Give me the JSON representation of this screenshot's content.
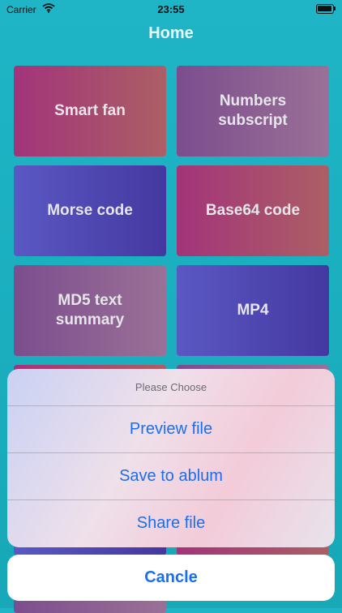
{
  "status_bar": {
    "carrier": "Carrier",
    "time": "23:55"
  },
  "nav": {
    "title": "Home"
  },
  "tiles": [
    {
      "label": "Smart fan"
    },
    {
      "label": "Numbers subscript"
    },
    {
      "label": "Morse code"
    },
    {
      "label": "Base64 code"
    },
    {
      "label": "MD5 text summary"
    },
    {
      "label": "MP4"
    }
  ],
  "action_sheet": {
    "title": "Please Choose",
    "options": [
      "Preview file",
      "Save to ablum",
      "Share file"
    ],
    "cancel": "Cancle"
  },
  "icons": {
    "wifi": "wifi-icon",
    "battery": "battery-icon"
  },
  "colors": {
    "accent": "#1a6ff0",
    "background": "#1fb5c6"
  }
}
